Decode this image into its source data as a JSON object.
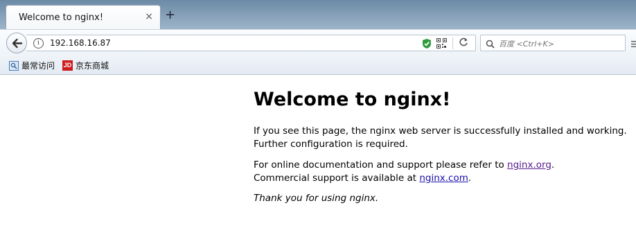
{
  "browser": {
    "tab": {
      "title": "Welcome to nginx!",
      "close": "×"
    },
    "new_tab": "+",
    "address_bar": {
      "url": "192.168.16.87"
    },
    "search_bar": {
      "placeholder": "百度 <Ctrl+K>"
    },
    "bookmarks": [
      {
        "label": "最常访问",
        "icon": "bookmark-folder-icon"
      },
      {
        "label": "京东商城",
        "icon": "jd-logo-icon",
        "icon_text": "JD"
      }
    ]
  },
  "page": {
    "heading": "Welcome to nginx!",
    "para1": {
      "line1": "If you see this page, the nginx web server is successfully installed and working.",
      "line2": "Further configuration is required."
    },
    "para2": {
      "line1_prefix": "For online documentation and support please refer to ",
      "link1": "nginx.org",
      "line1_suffix": ".",
      "line2_prefix": "Commercial support is available at ",
      "link2": "nginx.com",
      "line2_suffix": "."
    },
    "para3": "Thank you for using nginx."
  },
  "colors": {
    "link": "#1a0dab",
    "visited_link": "#551a8b",
    "shield": "#2e9b3c"
  }
}
